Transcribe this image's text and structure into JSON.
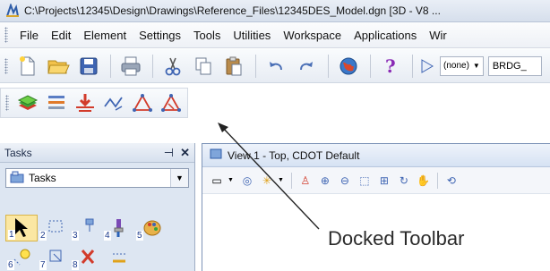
{
  "window": {
    "title": "C:\\Projects\\12345\\Design\\Drawings\\Reference_Files\\12345DES_Model.dgn [3D - V8 ..."
  },
  "menu": {
    "items": [
      "File",
      "Edit",
      "Element",
      "Settings",
      "Tools",
      "Utilities",
      "Workspace",
      "Applications",
      "Wir"
    ]
  },
  "toolbar": {
    "buttons": [
      "new-file-icon",
      "open-folder-icon",
      "save-icon",
      "print-icon",
      "cut-icon",
      "copy-icon",
      "paste-icon",
      "undo-icon",
      "redo-icon",
      "globe-icon",
      "help-icon"
    ],
    "level_display": "(none)",
    "level_name": "BRDG_"
  },
  "docked_toolbar": {
    "buttons": [
      "layers-icon",
      "level-filter-icon",
      "element-info-icon",
      "line-string-icon",
      "triangle-icon",
      "triangle-delete-icon"
    ]
  },
  "tasks": {
    "title": "Tasks",
    "selector_label": "Tasks",
    "tool_numbers_row1": [
      "1",
      "2",
      "3",
      "4",
      "5"
    ],
    "tool_numbers_row2": [
      "6",
      "7",
      "8"
    ]
  },
  "view": {
    "title": "View 1 - Top, CDOT Default"
  },
  "annotation": {
    "text": "Docked Toolbar"
  },
  "colors": {
    "accent": "#2f5da8",
    "selected_tool": "#fbe7a3",
    "panel_bg": "#dde6f2"
  }
}
